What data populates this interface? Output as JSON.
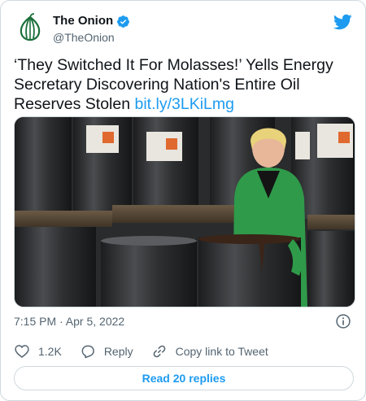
{
  "author": {
    "name": "The Onion",
    "handle": "@TheOnion"
  },
  "tweet": {
    "text": "‘They Switched It For Molasses!’ Yells Energy Secretary Discovering Nation's Entire Oil Reserves Stolen",
    "link": "bit.ly/3LKiLmg"
  },
  "meta": {
    "timestamp": "7:15 PM · Apr 5, 2022"
  },
  "actions": {
    "likes": "1.2K",
    "reply": "Reply",
    "copy_link": "Copy link to Tweet"
  },
  "replies_button": "Read 20 replies",
  "colors": {
    "accent": "#1d9bf0",
    "onion_green": "#1b6f3a",
    "muted": "#536471"
  },
  "icons": [
    "onion-logo-icon",
    "verified-icon",
    "twitter-bird-icon",
    "info-icon",
    "heart-icon",
    "reply-icon",
    "link-icon"
  ]
}
